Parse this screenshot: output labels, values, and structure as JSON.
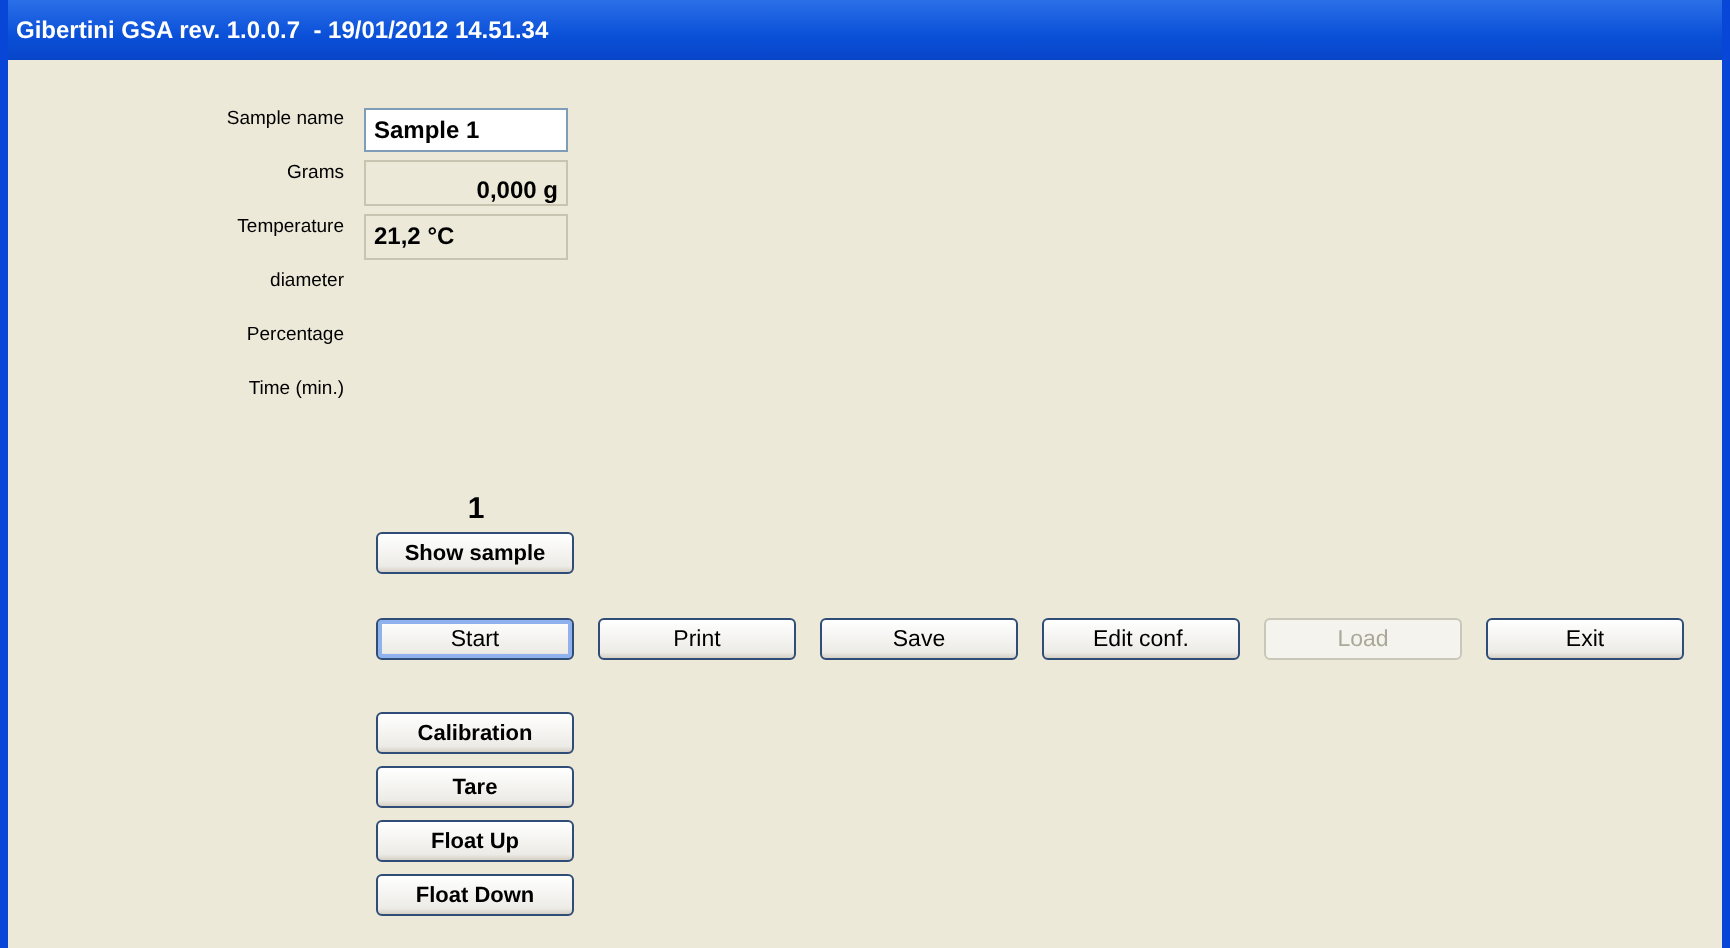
{
  "window": {
    "title": "Gibertini GSA rev. 1.0.0.7  - 19/01/2012 14.51.34"
  },
  "fields": [
    {
      "label": "Sample name",
      "kind": "input",
      "value": "Sample 1"
    },
    {
      "label": "Grams",
      "kind": "numeric",
      "value": "0,000 g"
    },
    {
      "label": "Temperature",
      "kind": "reading",
      "value": "21,2 °C"
    },
    {
      "label": "diameter",
      "kind": "none"
    },
    {
      "label": "Percentage",
      "kind": "none"
    },
    {
      "label": "Time (min.)",
      "kind": "none"
    }
  ],
  "sample_counter": "1",
  "show_sample_button": "Show sample",
  "action_buttons": [
    {
      "label": "Start",
      "focused": true,
      "disabled": false
    },
    {
      "label": "Print",
      "focused": false,
      "disabled": false
    },
    {
      "label": "Save",
      "focused": false,
      "disabled": false
    },
    {
      "label": "Edit conf.",
      "focused": false,
      "disabled": false
    },
    {
      "label": "Load",
      "focused": false,
      "disabled": true
    },
    {
      "label": "Exit",
      "focused": false,
      "disabled": false
    }
  ],
  "tool_buttons": [
    "Calibration",
    "Tare",
    "Float Up",
    "Float Down"
  ]
}
